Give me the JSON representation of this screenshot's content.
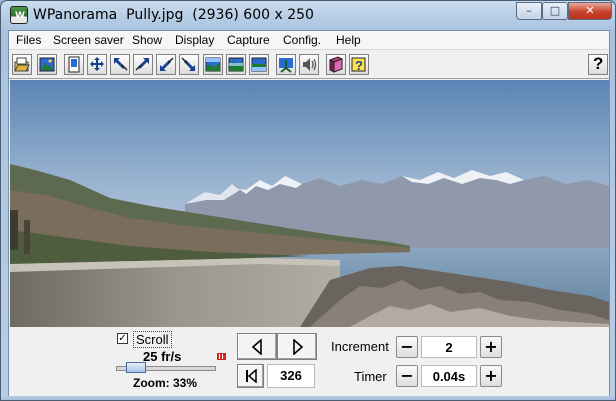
{
  "window": {
    "title": "WPanorama  Pully.jpg  (2936) 600 x 250",
    "app_icon_letter": "W",
    "controls": {
      "minimize": "–",
      "maximize": "□",
      "close": "✕"
    }
  },
  "menu": [
    "Files",
    "Screen saver",
    "Show",
    "Display",
    "Capture",
    "Config.",
    "Help"
  ],
  "toolbar": {
    "icons": [
      "open-file-icon",
      "image-icon",
      "fit-page-icon",
      "move-icon",
      "zoom-out-topleft-icon",
      "zoom-in-topright-icon",
      "zoom-in-bottomleft-icon",
      "zoom-out-bottomright-icon",
      "panorama-top-icon",
      "panorama-middle-icon",
      "panorama-bottom-icon",
      "tripod-icon",
      "sound-icon",
      "book-icon",
      "help-topics-icon"
    ],
    "help_label": "?"
  },
  "controls": {
    "scroll_checked": true,
    "check_mark": "✓",
    "scroll_label": "Scroll",
    "speed": "25 fr/s",
    "zoom_label": "Zoom: 33%",
    "position_value": "326",
    "increment_label": "Increment",
    "increment_value": "2",
    "timer_label": "Timer",
    "timer_value": "0.04s",
    "minus": "−",
    "plus": "+"
  },
  "colors": {
    "sky_top": "#5c84b4",
    "sky_bottom": "#c4d4e2",
    "lake": "#6f8faa",
    "mountains": "#8f99ab",
    "snow": "#eef2f6",
    "wall": "#8e8a80",
    "rocks": "#6a645e"
  }
}
